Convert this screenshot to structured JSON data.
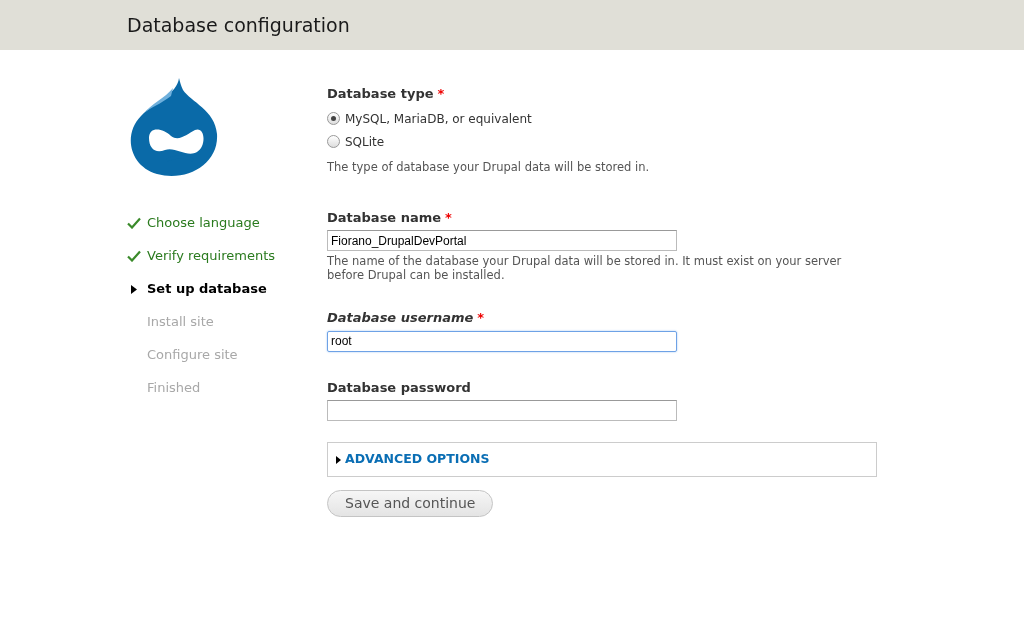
{
  "header": {
    "title": "Database configuration"
  },
  "steps": [
    {
      "label": "Choose language",
      "kind": "done"
    },
    {
      "label": "Verify requirements",
      "kind": "done"
    },
    {
      "label": "Set up database",
      "kind": "active"
    },
    {
      "label": "Install site",
      "kind": "pending"
    },
    {
      "label": "Configure site",
      "kind": "pending"
    },
    {
      "label": "Finished",
      "kind": "pending"
    }
  ],
  "database_type": {
    "label": "Database type",
    "required_mark": "*",
    "options": [
      {
        "label": "MySQL, MariaDB, or equivalent",
        "selected": true
      },
      {
        "label": "SQLite",
        "selected": false
      }
    ],
    "description": "The type of database your Drupal data will be stored in."
  },
  "fields": [
    {
      "label": "Database name",
      "required_mark": "*",
      "value": "Fiorano_DrupalDevPortal",
      "focused": false,
      "description": "The name of the database your Drupal data will be stored in. It must exist on your server before Drupal can be installed."
    },
    {
      "label": "Database username",
      "required_mark": "*",
      "value": "root",
      "focused": true
    },
    {
      "label": "Database password",
      "focused": false
    }
  ],
  "advanced": {
    "label": "ADVANCED OPTIONS",
    "expanded": false
  },
  "submit": "Save and continue"
}
